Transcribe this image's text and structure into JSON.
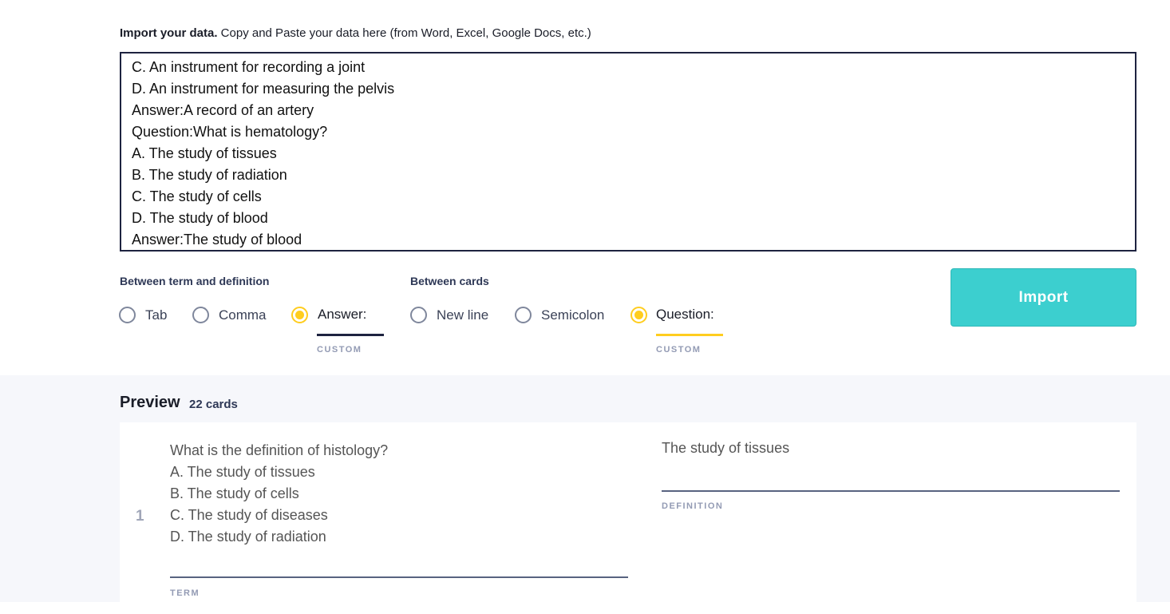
{
  "import": {
    "intro_bold": "Import your data.",
    "intro_rest": " Copy and Paste your data here (from Word, Excel, Google Docs, etc.)",
    "textarea_lines": [
      "C. An instrument for recording a joint",
      "D. An instrument for measuring the pelvis",
      "Answer:A record of an artery",
      "Question:What is hematology?",
      "A. The study of tissues",
      "B. The study of radiation",
      "C. The study of cells",
      "D. The study of blood",
      "Answer:The study of blood"
    ]
  },
  "term_def": {
    "label": "Between term and definition",
    "options": [
      "Tab",
      "Comma"
    ],
    "custom_value": "Answer:",
    "custom_label": "CUSTOM"
  },
  "cards_sep": {
    "label": "Between cards",
    "options": [
      "New line",
      "Semicolon"
    ],
    "custom_value": "Question:",
    "custom_label": "CUSTOM"
  },
  "import_button": "Import",
  "preview": {
    "title": "Preview",
    "count": "22 cards",
    "cards": [
      {
        "number": "1",
        "term_lines": [
          "What is the definition of histology?",
          "A. The study of tissues",
          "B. The study of cells",
          "C. The study of diseases",
          "D. The study of radiation"
        ],
        "term_label": "TERM",
        "definition": "The study of tissues",
        "definition_label": "DEFINITION"
      }
    ]
  },
  "colors": {
    "accent": "#ffcd1f",
    "button": "#3ccfcf"
  }
}
